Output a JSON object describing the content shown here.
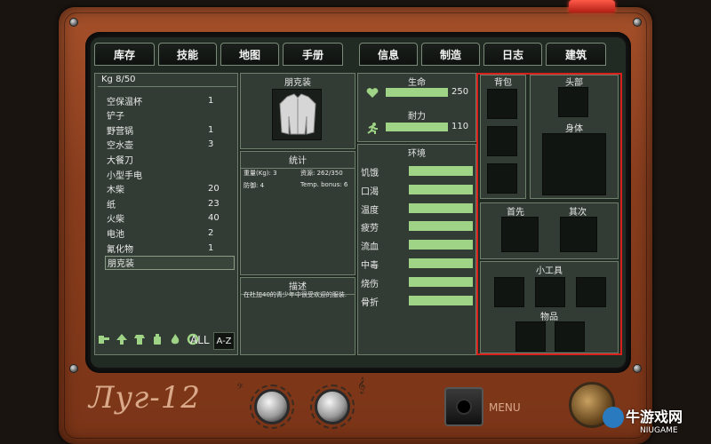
{
  "tabs": {
    "inventory": "库存",
    "skills": "技能",
    "map": "地图",
    "handbook": "手册",
    "info": "信息",
    "craft": "制造",
    "journal": "日志",
    "build": "建筑"
  },
  "inventory": {
    "weight": "Kg 8/50",
    "items": [
      {
        "name": "空保温杯",
        "count": "1"
      },
      {
        "name": "铲子",
        "count": ""
      },
      {
        "name": "野营锅",
        "count": "1"
      },
      {
        "name": "空水壶",
        "count": "3"
      },
      {
        "name": "大餐刀",
        "count": ""
      },
      {
        "name": "小型手电",
        "count": ""
      },
      {
        "name": "木柴",
        "count": "20"
      },
      {
        "name": "纸",
        "count": "23"
      },
      {
        "name": "火柴",
        "count": "40"
      },
      {
        "name": "电池",
        "count": "2"
      },
      {
        "name": "氰化物",
        "count": "1"
      },
      {
        "name": "朋克装",
        "count": ""
      }
    ],
    "filter_all": "ALL",
    "filter_az": "A-Z"
  },
  "detail": {
    "item_title": "朋克装",
    "stats_title": "统计",
    "weight_label": "重量(Kg): 3",
    "resource_label": "资源: 262/350",
    "defense_label": "防御: 4",
    "temp_label": "Temp. bonus: 6",
    "desc_title": "描述",
    "desc_text": "在杜加40的青少年中很受欢迎的服装."
  },
  "status": {
    "life_label": "生命",
    "life_value": "250",
    "stamina_label": "耐力",
    "stamina_value": "110",
    "env_title": "环境",
    "env_rows": [
      "饥饿",
      "口渴",
      "温度",
      "疲劳",
      "流血",
      "中毒",
      "烧伤",
      "骨折"
    ]
  },
  "equipment": {
    "backpack": "背包",
    "head": "头部",
    "body": "身体",
    "primary": "首先",
    "secondary": "其次",
    "gadgets": "小工具",
    "items": "物品"
  },
  "device": {
    "brand": "Луг-12",
    "menu": "MENU"
  },
  "watermark": {
    "site": "牛游戏网",
    "sub": "NIUGAME"
  },
  "colors": {
    "bar_green": "#9fd486",
    "highlight_red": "#d9201c",
    "device_copper": "#8a3e1e"
  }
}
